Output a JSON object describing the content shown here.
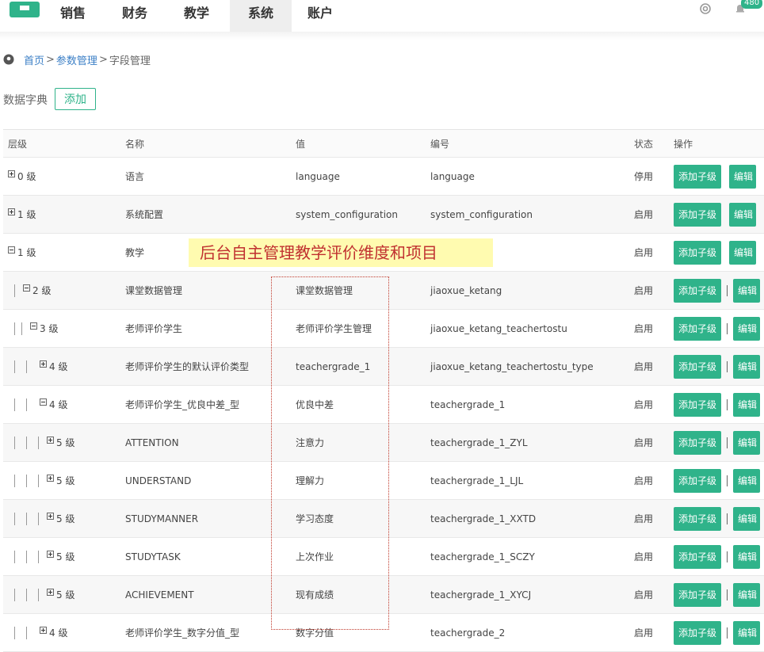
{
  "nav": {
    "items": [
      "销售",
      "财务",
      "教学",
      "系统",
      "账户"
    ],
    "active_index": 3,
    "badge_count": "480",
    "accent": "#2fb38a"
  },
  "breadcrumb": {
    "home": "首页",
    "parent": "参数管理",
    "current": "字段管理",
    "sep1": ">",
    "sep2": ">"
  },
  "toolbar": {
    "label": "数据字典",
    "add_label": "添加"
  },
  "table": {
    "headers": [
      "层级",
      "名称",
      "值",
      "编号",
      "状态",
      "操作"
    ],
    "action_sub_label": "添加子级",
    "action_edit_label": "编辑",
    "rows": [
      {
        "level": "0 级",
        "name": "语言",
        "value": "language",
        "code": "language",
        "status": "停用"
      },
      {
        "level": "1 级",
        "name": "系统配置",
        "value": "system_configuration",
        "code": "system_configuration",
        "status": "启用"
      },
      {
        "level": "1 级",
        "name": "教学",
        "value": "",
        "code": "",
        "status": "启用"
      },
      {
        "level": "2 级",
        "name": "课堂数据管理",
        "value": "课堂数据管理",
        "code": "jiaoxue_ketang",
        "status": "启用"
      },
      {
        "level": "3 级",
        "name": "老师评价学生",
        "value": "老师评价学生管理",
        "code": "jiaoxue_ketang_teachertostu",
        "status": "启用"
      },
      {
        "level": "4 级",
        "name": "老师评价学生的默认评价类型",
        "value": "teachergrade_1",
        "code": "jiaoxue_ketang_teachertostu_type",
        "status": "启用"
      },
      {
        "level": "4 级",
        "name": "老师评价学生_优良中差_型",
        "value": "优良中差",
        "code": "teachergrade_1",
        "status": "启用"
      },
      {
        "level": "5 级",
        "name": "ATTENTION",
        "value": "注意力",
        "code": "teachergrade_1_ZYL",
        "status": "启用"
      },
      {
        "level": "5 级",
        "name": "UNDERSTAND",
        "value": "理解力",
        "code": "teachergrade_1_LJL",
        "status": "启用"
      },
      {
        "level": "5 级",
        "name": "STUDYMANNER",
        "value": "学习态度",
        "code": "teachergrade_1_XXTD",
        "status": "启用"
      },
      {
        "level": "5 级",
        "name": "STUDYTASK",
        "value": "上次作业",
        "code": "teachergrade_1_SCZY",
        "status": "启用"
      },
      {
        "level": "5 级",
        "name": "ACHIEVEMENT",
        "value": "现有成绩",
        "code": "teachergrade_1_XYCJ",
        "status": "启用"
      },
      {
        "level": "4 级",
        "name": "老师评价学生_数字分值_型",
        "value": "数字分值",
        "code": "teachergrade_2",
        "status": "启用"
      }
    ]
  },
  "annotation": {
    "text": "后台自主管理教学评价维度和项目",
    "text_color": "#c03030",
    "highlight_color": "#fffbb0"
  }
}
